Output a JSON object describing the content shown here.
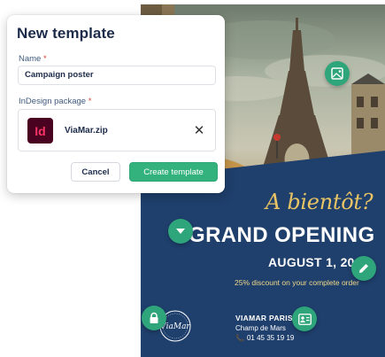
{
  "dialog": {
    "title": "New template",
    "name_label": "Name",
    "name_required": "*",
    "name_value": "Campaign poster",
    "package_label": "InDesign package",
    "package_required": "*",
    "file_icon_text": "Id",
    "file_name": "ViaMar.zip",
    "remove_glyph": "✕",
    "cancel_label": "Cancel",
    "create_label": "Create template"
  },
  "poster": {
    "slogan": "A bientôt?",
    "headline": "GRAND OPENING",
    "date": "AUGUST 1, 20",
    "discount": "25% discount on your complete order",
    "brand": "VIAMAR PARIS",
    "address": "Champ de Mars",
    "phone": "01 45 35 19 19",
    "phone_icon": "📞",
    "logo_text": "ViaMar",
    "colors": {
      "navy": "#1f3f6c",
      "gold": "#e8c464",
      "marker_green": "#2ea57a"
    }
  },
  "markers": {
    "image": "image-icon",
    "dropdown": "chevron-down-icon",
    "edit": "pencil-icon",
    "lock": "lock-icon",
    "contact": "contact-card-icon"
  }
}
